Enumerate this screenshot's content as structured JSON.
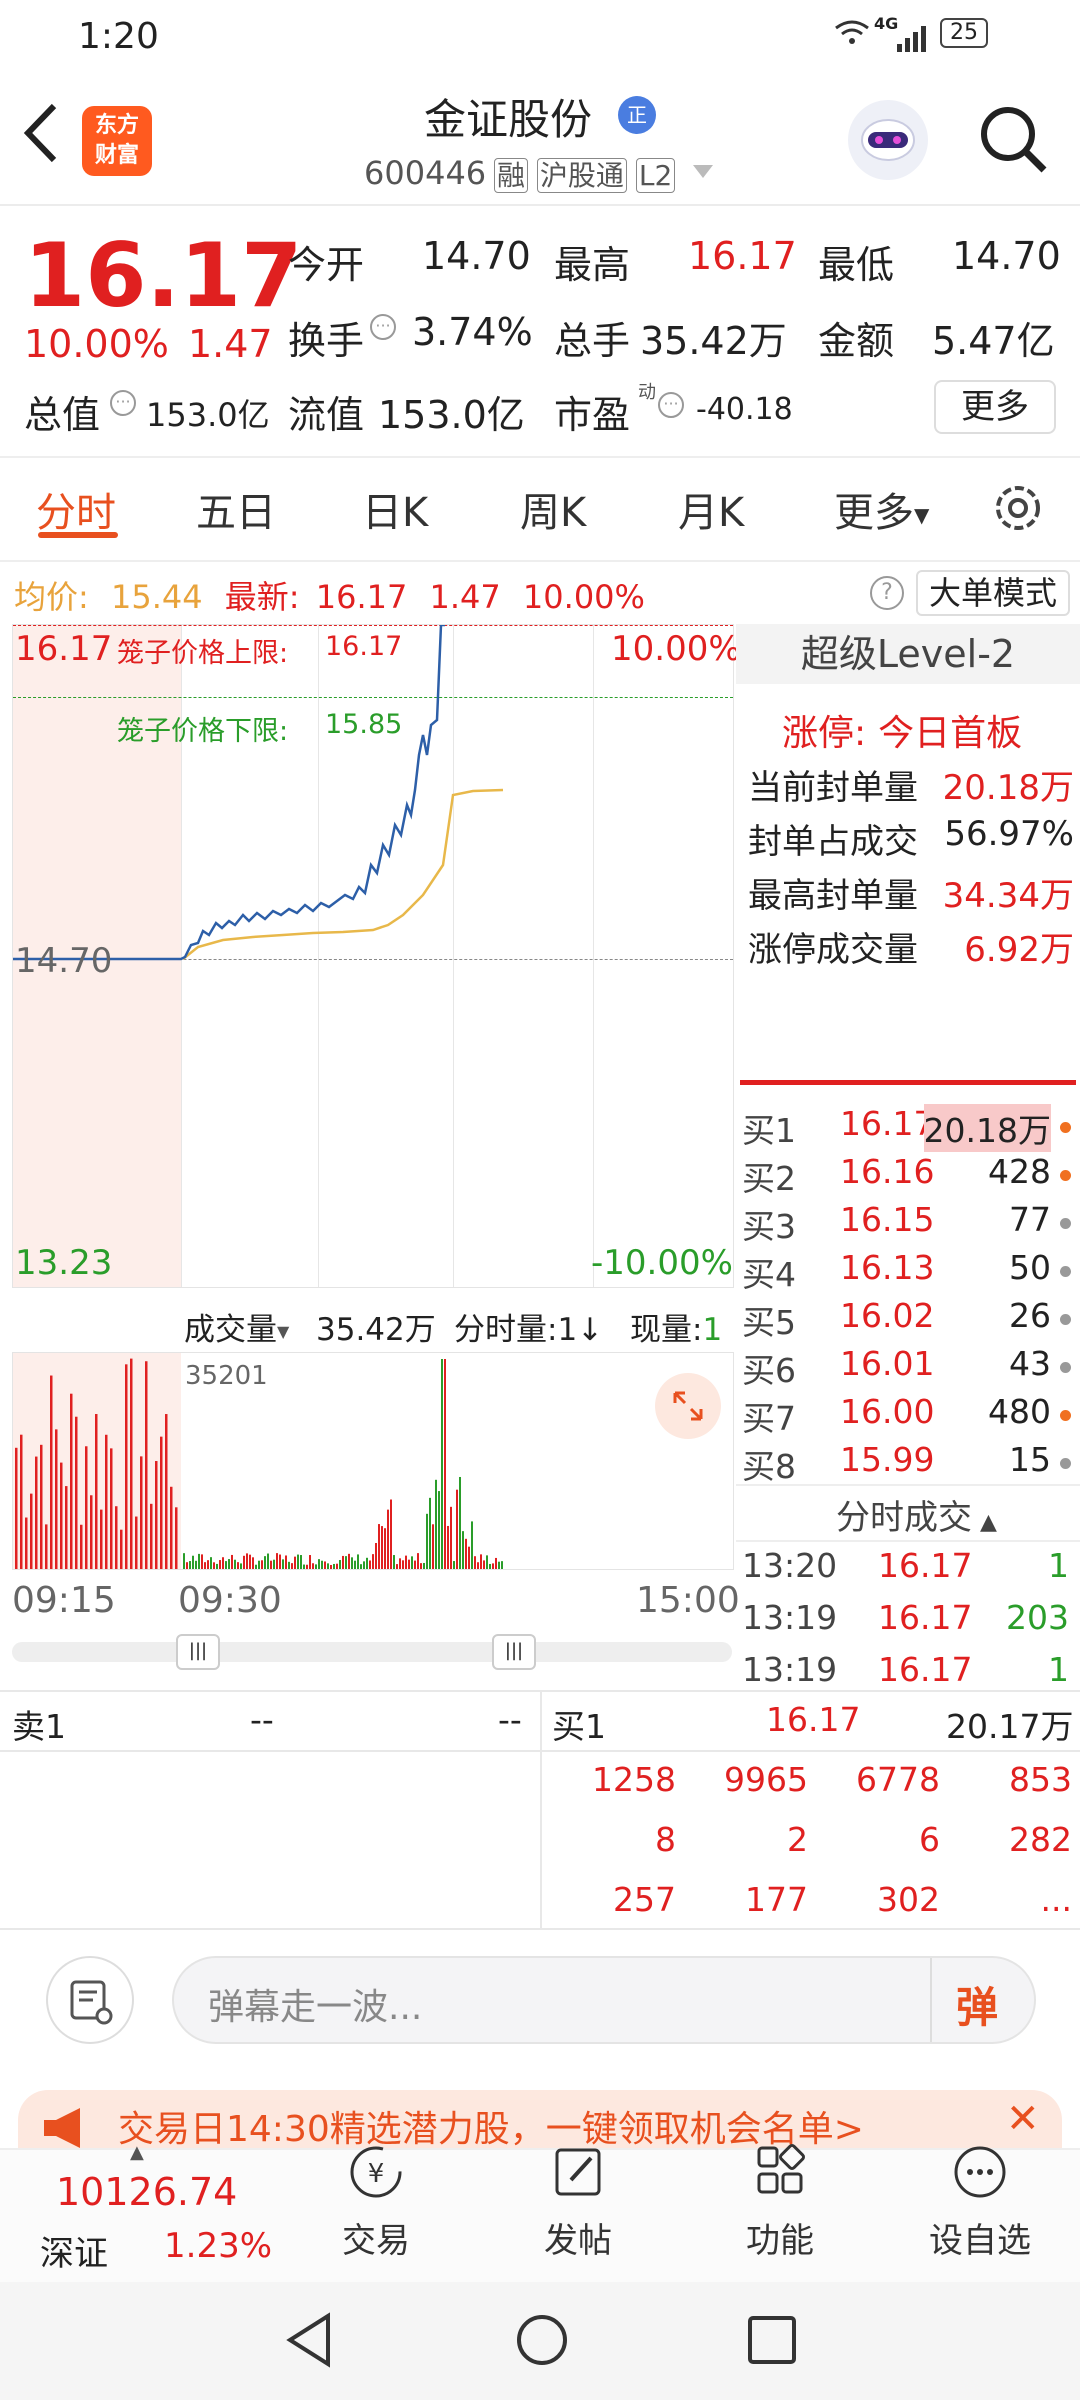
{
  "status": {
    "time": "1:20",
    "network": "4G",
    "battery": "25"
  },
  "header": {
    "stock_name": "金证股份",
    "name_badge": "正",
    "code": "600446",
    "tags": [
      "融",
      "沪股通",
      "L2"
    ],
    "logo_line1": "东方",
    "logo_line2": "财富"
  },
  "quote": {
    "price": "16.17",
    "pct": "10.00%",
    "chg": "1.47",
    "open_label": "今开",
    "open": "14.70",
    "high_label": "最高",
    "high": "16.17",
    "low_label": "最低",
    "low": "14.70",
    "turnover_label": "换手",
    "turnover": "3.74%",
    "volume_label": "总手",
    "volume": "35.42万",
    "amount_label": "金额",
    "amount": "5.47亿",
    "mktcap_label": "总值",
    "mktcap": "153.0亿",
    "float_label": "流值",
    "float": "153.0亿",
    "pe_label": "市盈",
    "pe_sup": "动",
    "pe": "-40.18",
    "more_button": "更多"
  },
  "tabs": [
    "分时",
    "五日",
    "日K",
    "周K",
    "月K",
    "更多"
  ],
  "avg_bar": {
    "avg_label": "均价:",
    "avg": "15.44",
    "latest_label": "最新:",
    "latest": "16.17",
    "chg": "1.47",
    "pct": "10.00%",
    "mode_button": "大单模式"
  },
  "chart": {
    "top_price": "16.17",
    "top_pct": "10.00%",
    "mid_price": "14.70",
    "bot_price": "13.23",
    "bot_pct": "-10.00%",
    "upper_label": "笼子价格上限:",
    "upper_value": "16.17",
    "lower_label": "笼子价格下限:",
    "lower_value": "15.85"
  },
  "volume_bar": {
    "indicator": "成交量",
    "value": "35.42万",
    "unit_label": "分时量:1",
    "unit_arrow": "↓",
    "now_label": "现量:",
    "now_value": "1",
    "peak": "35201"
  },
  "time_axis": {
    "start": "09:15",
    "open": "09:30",
    "end": "15:00"
  },
  "level2": {
    "title": "超级Level-2",
    "limit_label": "涨停:",
    "limit_value": "今日首板",
    "stats": [
      {
        "label": "当前封单量",
        "value": "20.18万"
      },
      {
        "label": "封单占成交",
        "value": "56.97%"
      },
      {
        "label": "最高封单量",
        "value": "34.34万"
      },
      {
        "label": "涨停成交量",
        "value": "6.92万"
      }
    ]
  },
  "bids": [
    {
      "label": "买1",
      "price": "16.17",
      "qty": "20.18万",
      "dot": "#f07020"
    },
    {
      "label": "买2",
      "price": "16.16",
      "qty": "428",
      "dot": "#f07020"
    },
    {
      "label": "买3",
      "price": "16.15",
      "qty": "77",
      "dot": "#999999"
    },
    {
      "label": "买4",
      "price": "16.13",
      "qty": "50",
      "dot": "#999999"
    },
    {
      "label": "买5",
      "price": "16.02",
      "qty": "26",
      "dot": "#999999"
    },
    {
      "label": "买6",
      "price": "16.01",
      "qty": "43",
      "dot": "#999999"
    },
    {
      "label": "买7",
      "price": "16.00",
      "qty": "480",
      "dot": "#f07020"
    },
    {
      "label": "买8",
      "price": "15.99",
      "qty": "15",
      "dot": "#999999"
    }
  ],
  "ticks_header": "分时成交",
  "ticks": [
    {
      "time": "13:20",
      "price": "16.17",
      "qty": "1"
    },
    {
      "time": "13:19",
      "price": "16.17",
      "qty": "203"
    },
    {
      "time": "13:19",
      "price": "16.17",
      "qty": "1"
    }
  ],
  "sell1": {
    "label": "卖1",
    "price": "--",
    "qty": "--"
  },
  "buy1": {
    "label": "买1",
    "price": "16.17",
    "qty": "20.17万"
  },
  "queue": [
    [
      "1258",
      "9965",
      "6778",
      "853"
    ],
    [
      "8",
      "2",
      "6",
      "282"
    ],
    [
      "257",
      "177",
      "302",
      "..."
    ]
  ],
  "danmu": {
    "placeholder": "弹幕走一波...",
    "button": "弹"
  },
  "banner": {
    "text": "交易日14:30精选潜力股，一键领取机会名单>"
  },
  "bottom": {
    "index_value": "10126.74",
    "index_name": "深证",
    "index_pct": "1.23%",
    "items": [
      "交易",
      "发帖",
      "功能",
      "设自选"
    ]
  }
}
